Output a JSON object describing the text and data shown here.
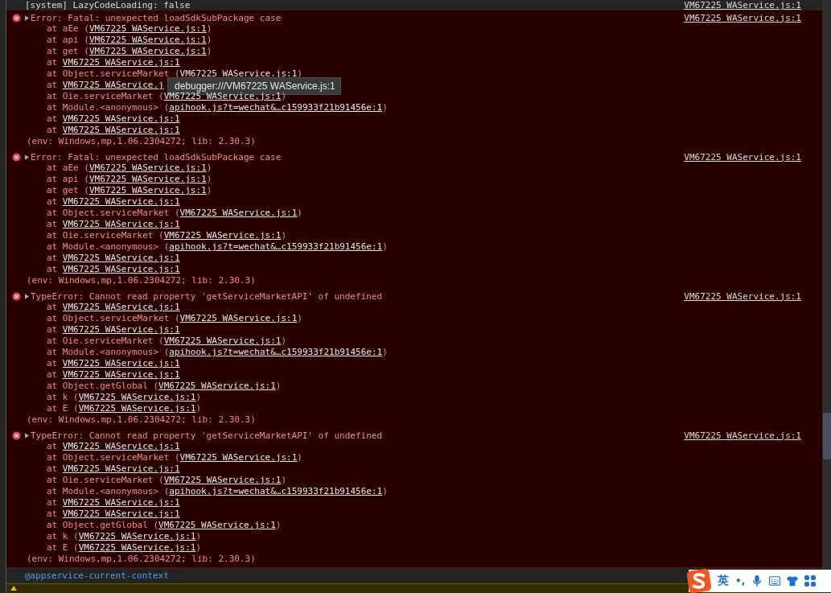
{
  "system_line": {
    "text": "[system] LazyCodeLoading: false",
    "source": "VM67225 WAService.js:1"
  },
  "entries": [
    {
      "kind": "error",
      "message": "Error: Fatal: unexpected loadSdkSubPackage case",
      "source": "VM67225 WAService.js:1",
      "expanded": false,
      "frames": [
        {
          "prefix": "at aEe (",
          "link": "VM67225 WAService.js:1",
          "suffix": ")"
        },
        {
          "prefix": "at api (",
          "link": "VM67225 WAService.js:1",
          "suffix": ")"
        },
        {
          "prefix": "at get (",
          "link": "VM67225 WAService.js:1",
          "suffix": ")"
        },
        {
          "prefix": "at",
          "link": "VM67225 WAService.js:1"
        },
        {
          "prefix": "at Object.serviceMarket (",
          "link": "VM67225 WAService.js:1",
          "suffix": ")"
        },
        {
          "prefix": "at",
          "link": "VM67225 WAService.j"
        },
        {
          "prefix": "at Oie.serviceMarket (",
          "link": "VM67225 WAService.js:1",
          "suffix": ")"
        },
        {
          "prefix": "at Module.<anonymous> (",
          "link": "apihook.js?t=wechat&…c159933f21b91456e:1",
          "suffix": ")"
        },
        {
          "prefix": "at",
          "link": "VM67225 WAService.js:1"
        },
        {
          "prefix": "at",
          "link": "VM67225 WAService.js:1"
        }
      ],
      "env": "(env: Windows,mp,1.06.2304272; lib: 2.30.3)"
    },
    {
      "kind": "error",
      "message": "Error: Fatal: unexpected loadSdkSubPackage case",
      "source": "VM67225 WAService.js:1",
      "expanded": false,
      "frames": [
        {
          "prefix": "at aEe (",
          "link": "VM67225 WAService.js:1",
          "suffix": ")"
        },
        {
          "prefix": "at api (",
          "link": "VM67225 WAService.js:1",
          "suffix": ")"
        },
        {
          "prefix": "at get (",
          "link": "VM67225 WAService.js:1",
          "suffix": ")"
        },
        {
          "prefix": "at",
          "link": "VM67225 WAService.js:1"
        },
        {
          "prefix": "at Object.serviceMarket (",
          "link": "VM67225 WAService.js:1",
          "suffix": ")"
        },
        {
          "prefix": "at",
          "link": "VM67225 WAService.js:1"
        },
        {
          "prefix": "at Oie.serviceMarket (",
          "link": "VM67225 WAService.js:1",
          "suffix": ")"
        },
        {
          "prefix": "at Module.<anonymous> (",
          "link": "apihook.js?t=wechat&…c159933f21b91456e:1",
          "suffix": ")"
        },
        {
          "prefix": "at",
          "link": "VM67225 WAService.js:1"
        },
        {
          "prefix": "at",
          "link": "VM67225 WAService.js:1"
        }
      ],
      "env": "(env: Windows,mp,1.06.2304272; lib: 2.30.3)"
    },
    {
      "kind": "error",
      "message": "TypeError: Cannot read property 'getServiceMarketAPI' of undefined",
      "source": "VM67225 WAService.js:1",
      "expanded": false,
      "frames": [
        {
          "prefix": "at",
          "link": "VM67225 WAService.js:1"
        },
        {
          "prefix": "at Object.serviceMarket (",
          "link": "VM67225 WAService.js:1",
          "suffix": ")"
        },
        {
          "prefix": "at",
          "link": "VM67225 WAService.js:1"
        },
        {
          "prefix": "at Oie.serviceMarket (",
          "link": "VM67225 WAService.js:1",
          "suffix": ")"
        },
        {
          "prefix": "at Module.<anonymous> (",
          "link": "apihook.js?t=wechat&…c159933f21b91456e:1",
          "suffix": ")"
        },
        {
          "prefix": "at",
          "link": "VM67225 WAService.js:1"
        },
        {
          "prefix": "at",
          "link": "VM67225 WAService.js:1"
        },
        {
          "prefix": "at Object.getGlobal (",
          "link": "VM67225 WAService.js:1",
          "suffix": ")"
        },
        {
          "prefix": "at k (",
          "link": "VM67225 WAService.js:1",
          "suffix": ")"
        },
        {
          "prefix": "at E (",
          "link": "VM67225 WAService.js:1",
          "suffix": ")"
        }
      ],
      "env": "(env: Windows,mp,1.06.2304272; lib: 2.30.3)"
    },
    {
      "kind": "error",
      "message": "TypeError: Cannot read property 'getServiceMarketAPI' of undefined",
      "source": "VM67225 WAService.js:1",
      "expanded": false,
      "frames": [
        {
          "prefix": "at",
          "link": "VM67225 WAService.js:1"
        },
        {
          "prefix": "at Object.serviceMarket (",
          "link": "VM67225 WAService.js:1",
          "suffix": ")"
        },
        {
          "prefix": "at",
          "link": "VM67225 WAService.js:1"
        },
        {
          "prefix": "at Oie.serviceMarket (",
          "link": "VM67225 WAService.js:1",
          "suffix": ")"
        },
        {
          "prefix": "at Module.<anonymous> (",
          "link": "apihook.js?t=wechat&…c159933f21b91456e:1",
          "suffix": ")"
        },
        {
          "prefix": "at",
          "link": "VM67225 WAService.js:1"
        },
        {
          "prefix": "at",
          "link": "VM67225 WAService.js:1"
        },
        {
          "prefix": "at Object.getGlobal (",
          "link": "VM67225 WAService.js:1",
          "suffix": ")"
        },
        {
          "prefix": "at k (",
          "link": "VM67225 WAService.js:1",
          "suffix": ")"
        },
        {
          "prefix": "at E (",
          "link": "VM67225 WAService.js:1",
          "suffix": ")"
        }
      ],
      "env": "(env: Windows,mp,1.06.2304272; lib: 2.30.3)"
    }
  ],
  "tooltip": {
    "text": "debugger:///VM67225 WAService.js:1"
  },
  "context": {
    "text": "@appservice-current-context"
  },
  "ime_toolbar": {
    "language": "英",
    "punctuation": "•,"
  }
}
